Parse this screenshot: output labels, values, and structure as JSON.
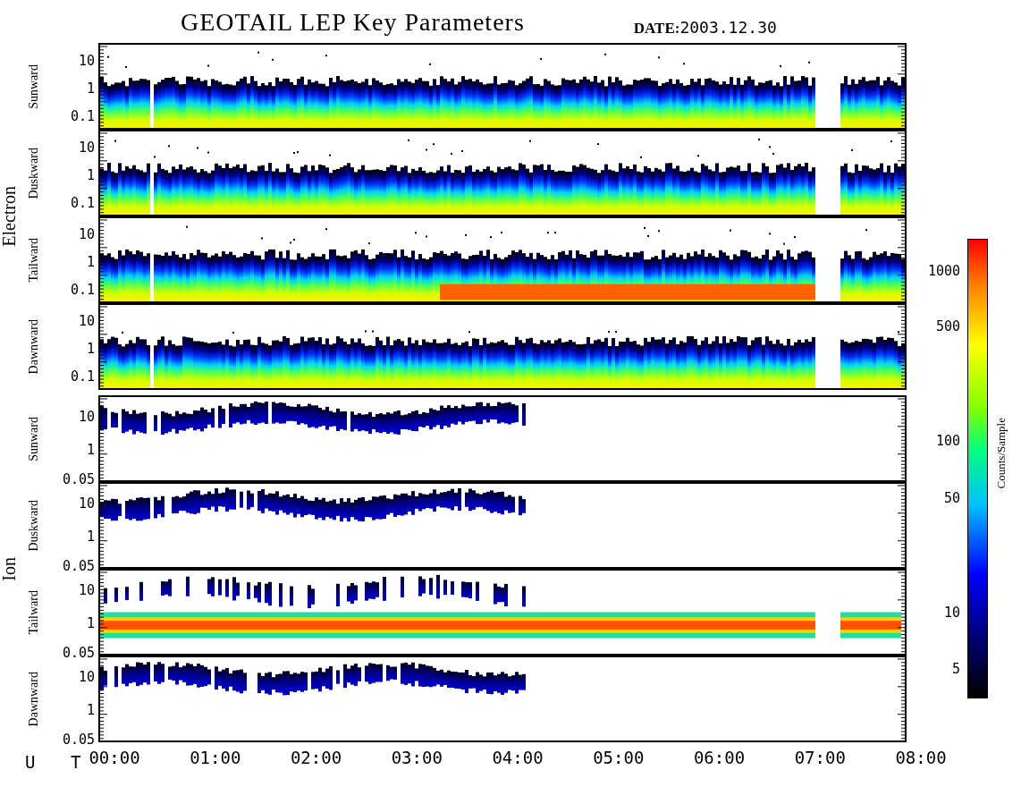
{
  "title": "GEOTAIL LEP Key Parameters",
  "date_label": "DATE:",
  "date": "2003.12.30",
  "groups": [
    {
      "label": "Electron",
      "kind": "electron",
      "panels": [
        {
          "label": "Sunward",
          "yticks": [
            "10",
            "1",
            "0.1"
          ]
        },
        {
          "label": "Duskward",
          "yticks": [
            "10",
            "1",
            "0.1"
          ]
        },
        {
          "label": "Tailward",
          "yticks": [
            "10",
            "1",
            "0.1"
          ]
        },
        {
          "label": "Dawnward",
          "yticks": [
            "10",
            "1",
            "0.1"
          ]
        }
      ]
    },
    {
      "label": "Ion",
      "kind": "ion",
      "panels": [
        {
          "label": "Sunward",
          "yticks": [
            "10",
            "1",
            "0.05"
          ]
        },
        {
          "label": "Duskward",
          "yticks": [
            "10",
            "1",
            "0.05"
          ]
        },
        {
          "label": "Tailward",
          "yticks": [
            "10",
            "1",
            "0.05"
          ]
        },
        {
          "label": "Dawnward",
          "yticks": [
            "10",
            "1",
            "0.05"
          ]
        }
      ]
    }
  ],
  "x_axis": {
    "label": "U T",
    "ticks": [
      "00:00",
      "01:00",
      "02:00",
      "03:00",
      "04:00",
      "05:00",
      "06:00",
      "07:00",
      "08:00"
    ]
  },
  "colorbar": {
    "label": "Counts/Sample",
    "ticks": [
      "1000",
      "500",
      "100",
      "50",
      "10",
      "5"
    ]
  }
}
